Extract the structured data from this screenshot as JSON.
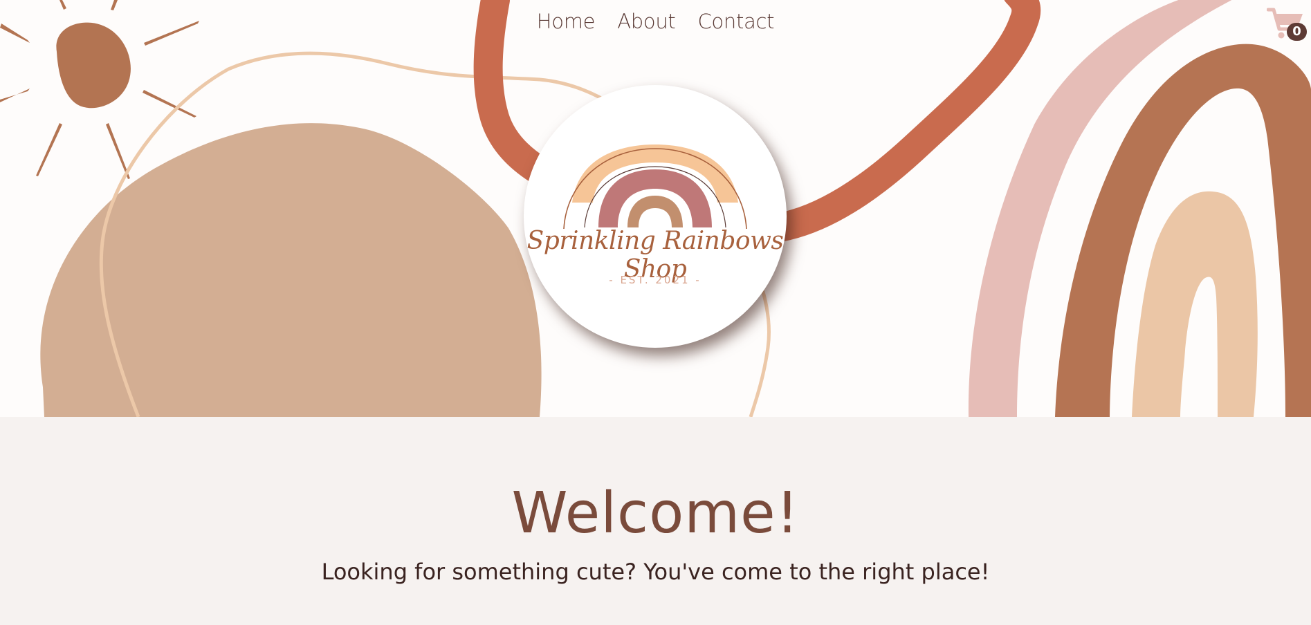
{
  "nav": {
    "items": [
      {
        "label": "Home"
      },
      {
        "label": "About"
      },
      {
        "label": "Contact"
      }
    ]
  },
  "cart": {
    "count": "0",
    "icon": "shopping-cart-icon"
  },
  "logo": {
    "name": "Sprinkling Rainbows Shop",
    "established": "- EST. 2021 -"
  },
  "main": {
    "heading": "Welcome!",
    "tagline": "Looking for something cute? You've come to the right place!"
  },
  "colors": {
    "hero_background": "#fefcfb",
    "page_background": "#f6f2f0",
    "terracotta": "#c96b4e",
    "brown": "#b57453",
    "tan": "#d3ae93",
    "peach": "#ebc6a6",
    "blush": "#e6bdb7",
    "heading": "#7a4b3b"
  }
}
